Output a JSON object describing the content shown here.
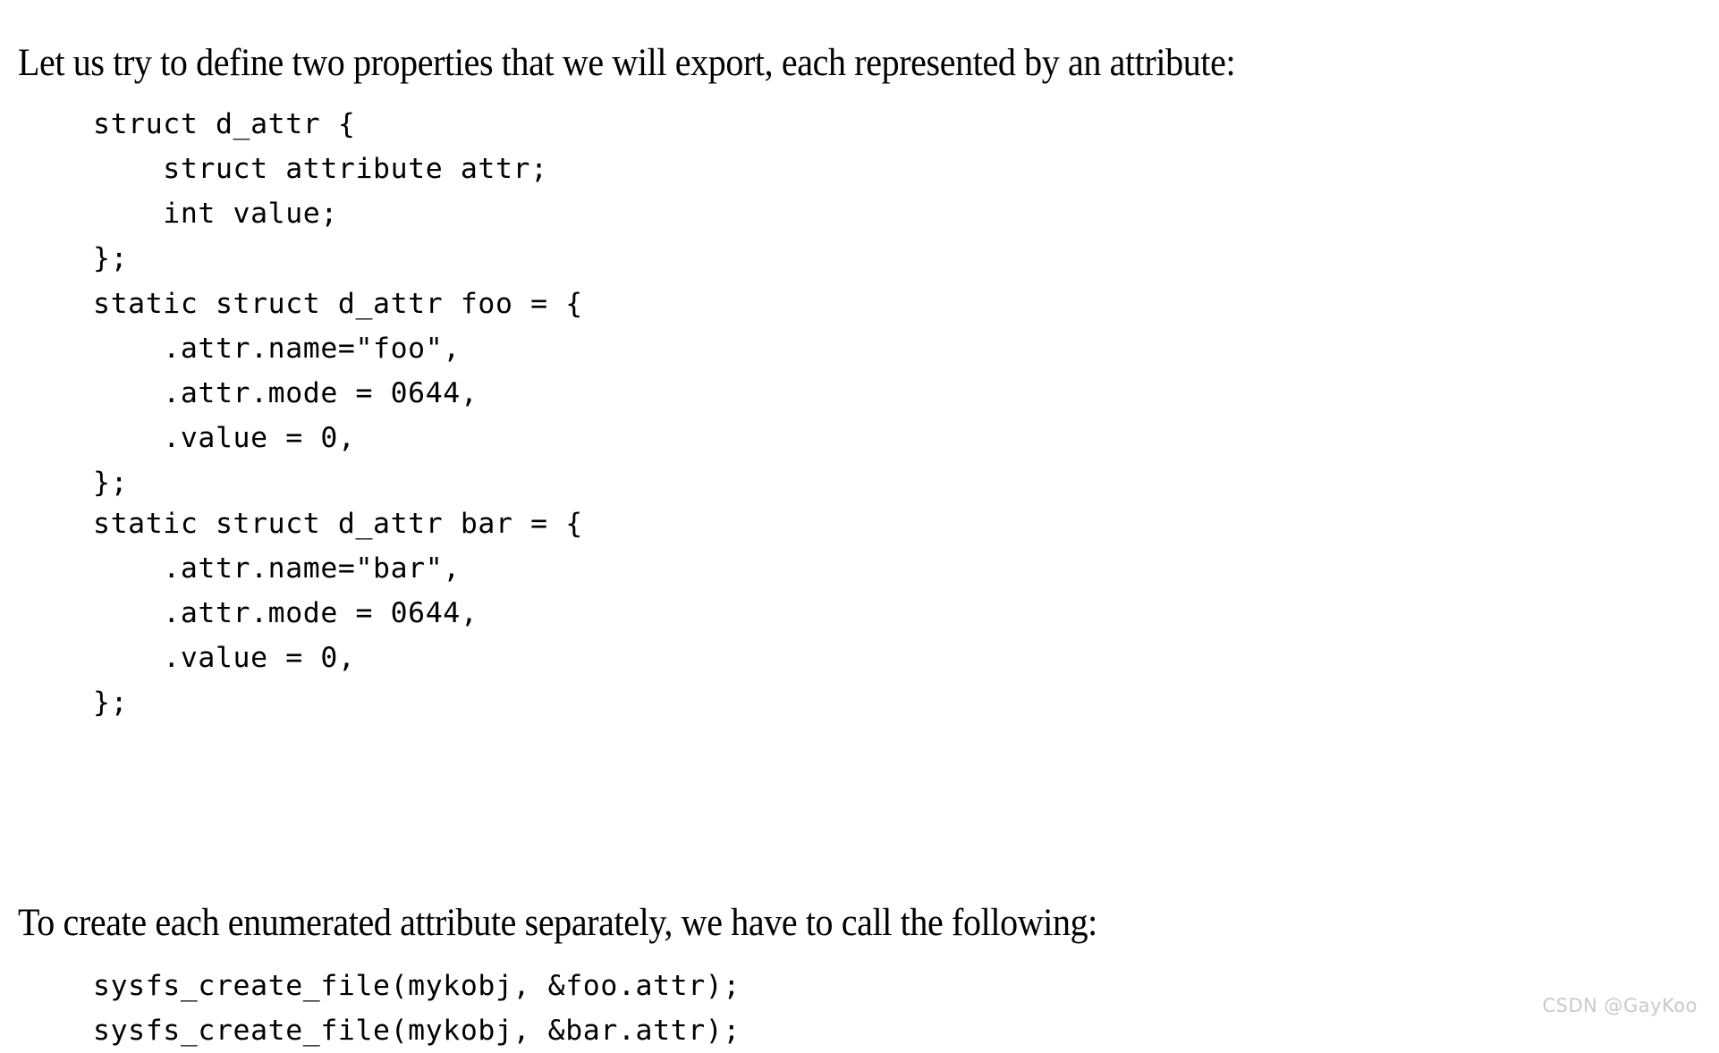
{
  "document": {
    "background_color": "#ffffff",
    "text_color": "#000000"
  },
  "intro_paragraph": "Let us try to define two properties that we will export, each represented by an attribute:",
  "create_paragraph": "To create each enumerated attribute separately, we have to call the following:",
  "code_blocks": {
    "struct_definition": {
      "lines": [
        "struct d_attr {",
        "    struct attribute attr;",
        "    int value;",
        "};"
      ]
    },
    "foo_definition": {
      "lines": [
        "static struct d_attr foo = {",
        "    .attr.name=\"foo\",",
        "    .attr.mode = 0644,",
        "    .value = 0,",
        "};"
      ]
    },
    "bar_definition": {
      "lines": [
        "static struct d_attr bar = {",
        "    .attr.name=\"bar\",",
        "    .attr.mode = 0644,",
        "    .value = 0,",
        "};"
      ]
    },
    "sysfs_calls": {
      "lines": [
        "sysfs_create_file(mykobj, &foo.attr);",
        "sysfs_create_file(mykobj, &bar.attr);"
      ]
    }
  },
  "watermark": {
    "text": "CSDN @GayKoo",
    "color": "#c9c9c9"
  }
}
